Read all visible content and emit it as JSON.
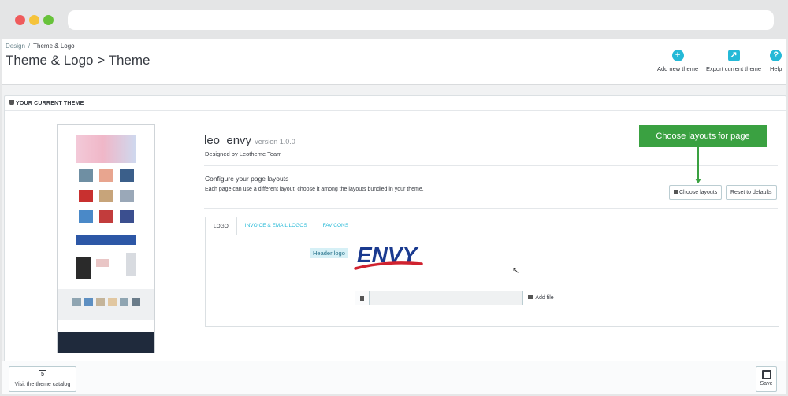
{
  "breadcrumb": {
    "parent": "Design",
    "separator": "/",
    "current": "Theme & Logo"
  },
  "page_title": "Theme & Logo > Theme",
  "toolbar": {
    "add_new_theme": "Add new theme",
    "export_current_theme": "Export current theme",
    "help": "Help",
    "add_icon": "+",
    "export_icon": "↗",
    "help_icon": "?"
  },
  "panel": {
    "heading": "YOUR CURRENT THEME"
  },
  "theme": {
    "name": "leo_envy",
    "version": "version 1.0.0",
    "designed_by": "Designed by Leotheme Team"
  },
  "layouts": {
    "title": "Configure your page layouts",
    "description": "Each page can use a different layout, choose it among the layouts bundled in your theme.",
    "choose_button": "Choose layouts",
    "reset_button": "Reset to defaults"
  },
  "callout": "Choose layouts for page",
  "tabs": [
    {
      "label": "LOGO",
      "active": true
    },
    {
      "label": "INVOICE & EMAIL LOGOS",
      "active": false
    },
    {
      "label": "FAVICONS",
      "active": false
    }
  ],
  "logo_tab": {
    "header_logo_label": "Header logo",
    "logo_text": "ENVY",
    "add_file_button": "Add file"
  },
  "footer": {
    "catalog_button": "Visit the theme catalog",
    "save_button": "Save"
  },
  "colors": {
    "accent": "#25b9d7",
    "callout_green": "#3aa141",
    "logo_blue": "#1a3a8f",
    "logo_red": "#d0222f"
  }
}
